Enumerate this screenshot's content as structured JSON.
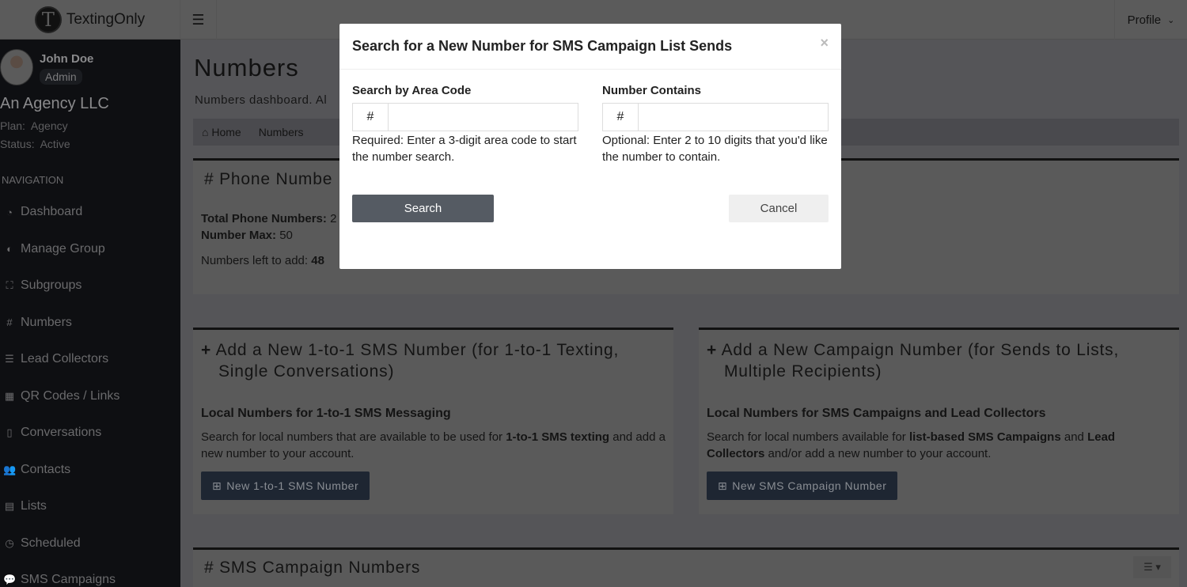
{
  "header": {
    "brand": "TextingOnly",
    "logo_letter": "T",
    "profile": "Profile"
  },
  "sidebar": {
    "user_name": "John Doe",
    "role": "Admin",
    "agency": "An Agency LLC",
    "plan": "Plan:  Agency",
    "status": "Status:  Active",
    "nav_heading": "NAVIGATION",
    "items": [
      {
        "label": "Dashboard",
        "icon": "tachometer-icon"
      },
      {
        "label": "Manage Group",
        "icon": "adjust-icon"
      },
      {
        "label": "Subgroups",
        "icon": "sitemap-icon"
      },
      {
        "label": "Numbers",
        "icon": "hash-icon"
      },
      {
        "label": "Lead Collectors",
        "icon": "database-icon"
      },
      {
        "label": "QR Codes / Links",
        "icon": "qrcode-icon"
      },
      {
        "label": "Conversations",
        "icon": "mobile-icon"
      },
      {
        "label": "Contacts",
        "icon": "users-icon"
      },
      {
        "label": "Lists",
        "icon": "list-icon"
      },
      {
        "label": "Scheduled",
        "icon": "clock-icon"
      },
      {
        "label": "SMS Campaigns",
        "icon": "comments-icon"
      }
    ]
  },
  "main": {
    "title": "Numbers",
    "subtitle": "Numbers dashboard. Al",
    "breadcrumb": [
      "Home",
      "Numbers"
    ],
    "phone_card": {
      "title": "Phone Numbe",
      "total_label": "Total Phone Numbers:",
      "total_value": "2",
      "max_label": "Number Max:",
      "max_value": "50",
      "left_label": "Numbers left to add:",
      "left_value": "48"
    },
    "one_to_one": {
      "title": "Add a New 1-to-1 SMS Number (for 1-to-1 Texting, Single Conversations)",
      "heading": "Local Numbers for 1-to-1 SMS Messaging",
      "text_a": "Search for local numbers that are available to be used for ",
      "text_bold": "1-to-1 SMS texting",
      "text_b": " and add a new number to your account.",
      "button": "New 1-to-1 SMS Number"
    },
    "campaign": {
      "title": "Add a New Campaign Number (for Sends to Lists, Multiple Recipients)",
      "heading": "Local Numbers for SMS Campaigns and Lead Collectors",
      "text_a": "Search for local numbers available for ",
      "text_bold1": "list-based SMS Campaigns",
      "text_b": " and ",
      "text_bold2": "Lead Collectors",
      "text_c": " and/or add a new number to your account.",
      "button": "New SMS Campaign Number"
    },
    "campaign_numbers": {
      "title": "SMS Campaign Numbers"
    }
  },
  "modal": {
    "title": "Search for a New Number for SMS Campaign List Sends",
    "close": "×",
    "area_code": {
      "label": "Search by Area Code",
      "addon": "#",
      "value": "",
      "help": "Required: Enter a 3-digit area code to start the number search."
    },
    "contains": {
      "label": "Number Contains",
      "addon": "#",
      "value": "",
      "help": "Optional: Enter 2 to 10 digits that you'd like the number to contain."
    },
    "search_button": "Search",
    "cancel_button": "Cancel"
  }
}
